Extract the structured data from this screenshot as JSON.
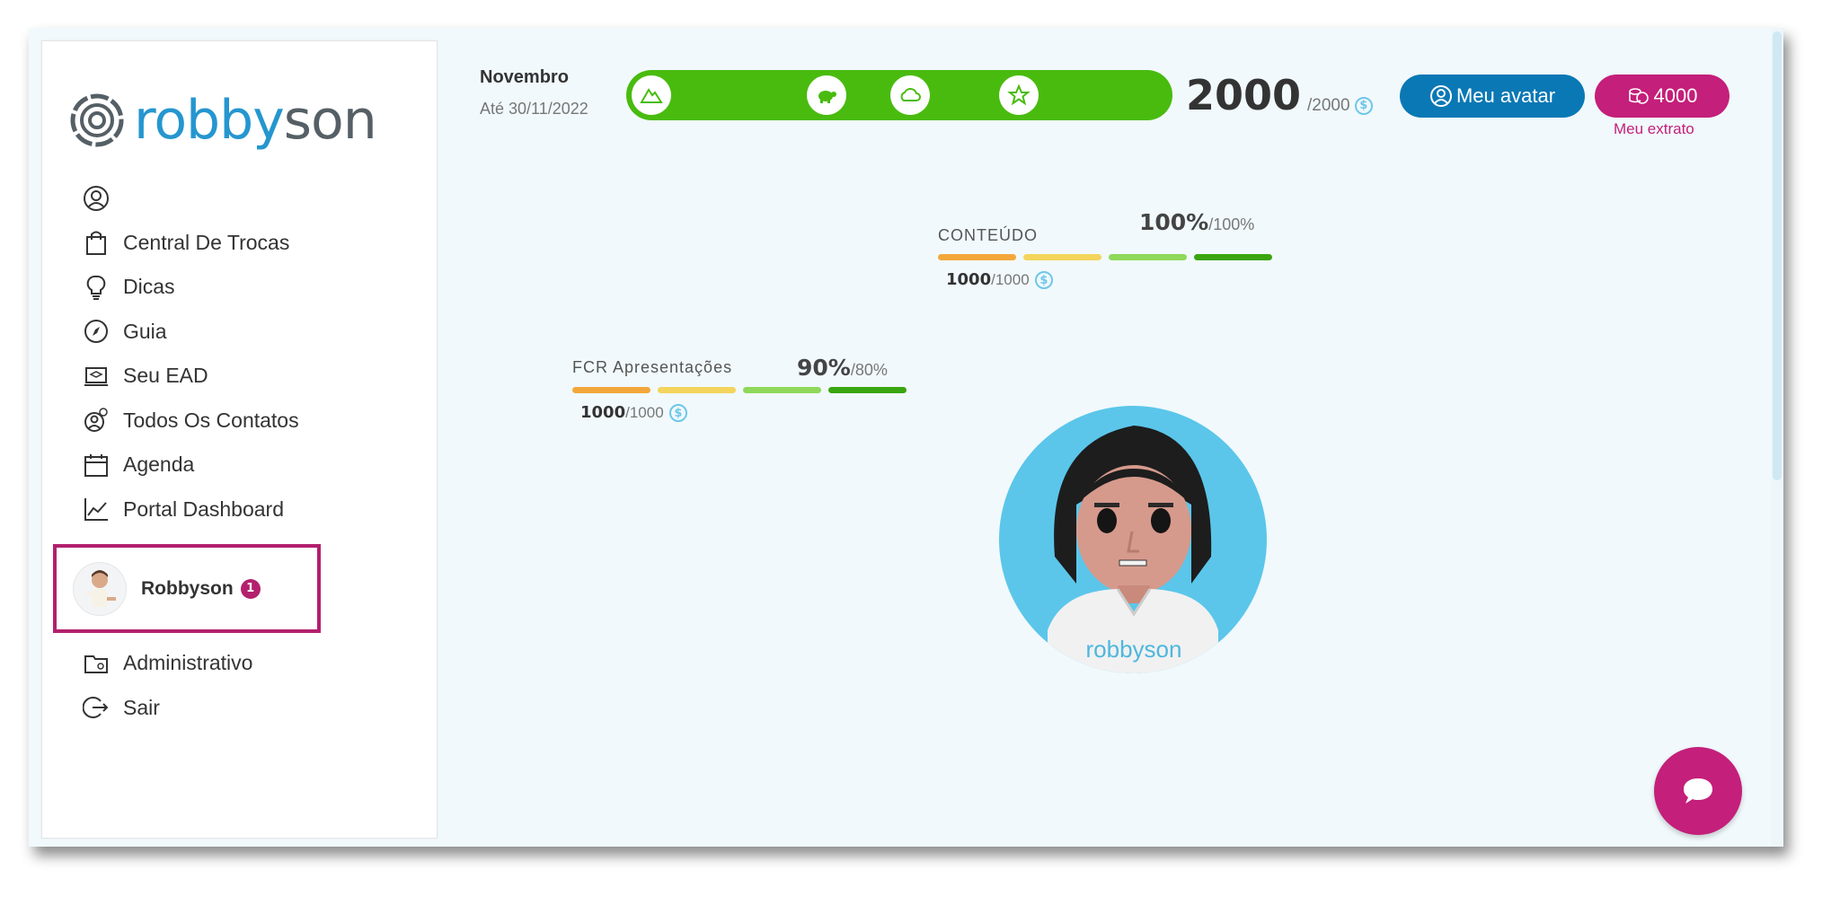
{
  "brand": {
    "logo_part1": "robby",
    "logo_part2": "son"
  },
  "sidebar": {
    "items": [
      {
        "label": "",
        "icon": "user-circle-icon"
      },
      {
        "label": "Central De Trocas",
        "icon": "shopping-bag-icon"
      },
      {
        "label": "Dicas",
        "icon": "lightbulb-icon"
      },
      {
        "label": "Guia",
        "icon": "compass-icon"
      },
      {
        "label": "Seu EAD",
        "icon": "laptop-graduation-icon"
      },
      {
        "label": "Todos Os Contatos",
        "icon": "contacts-icon"
      },
      {
        "label": "Agenda",
        "icon": "calendar-icon"
      },
      {
        "label": "Portal Dashboard",
        "icon": "line-chart-icon"
      }
    ],
    "user": {
      "name": "Robbyson",
      "notifications": "1"
    },
    "items_after": [
      {
        "label": "Administrativo",
        "icon": "admin-folder-icon"
      },
      {
        "label": "Sair",
        "icon": "logout-icon"
      }
    ]
  },
  "header": {
    "month": "Novembro",
    "until": "Até 30/11/2022",
    "score": "2000",
    "score_total": "/2000",
    "progress_icons": [
      "mountain-icon",
      "turtle-icon",
      "cloud-icon",
      "star-icon"
    ],
    "avatar_button": "Meu avatar",
    "coins_button": "4000",
    "extrato_link": "Meu extrato"
  },
  "skills": [
    {
      "name": "CONTEÚDO",
      "pct": "100%",
      "pct_total": "/100%",
      "points": "1000",
      "points_total": "/1000"
    },
    {
      "name": "FCR Apresentações",
      "pct": "90%",
      "pct_total": "/80%",
      "points": "1000",
      "points_total": "/1000"
    }
  ],
  "colors": {
    "accent_blue": "#0a78b5",
    "accent_pink": "#c41f7a",
    "progress_green": "#49bb0f",
    "seg_orange": "#f3a73b",
    "seg_yellow": "#f3d45c",
    "seg_lightgreen": "#8fd85a",
    "seg_green": "#3aa50f"
  },
  "coin_symbol": "$"
}
